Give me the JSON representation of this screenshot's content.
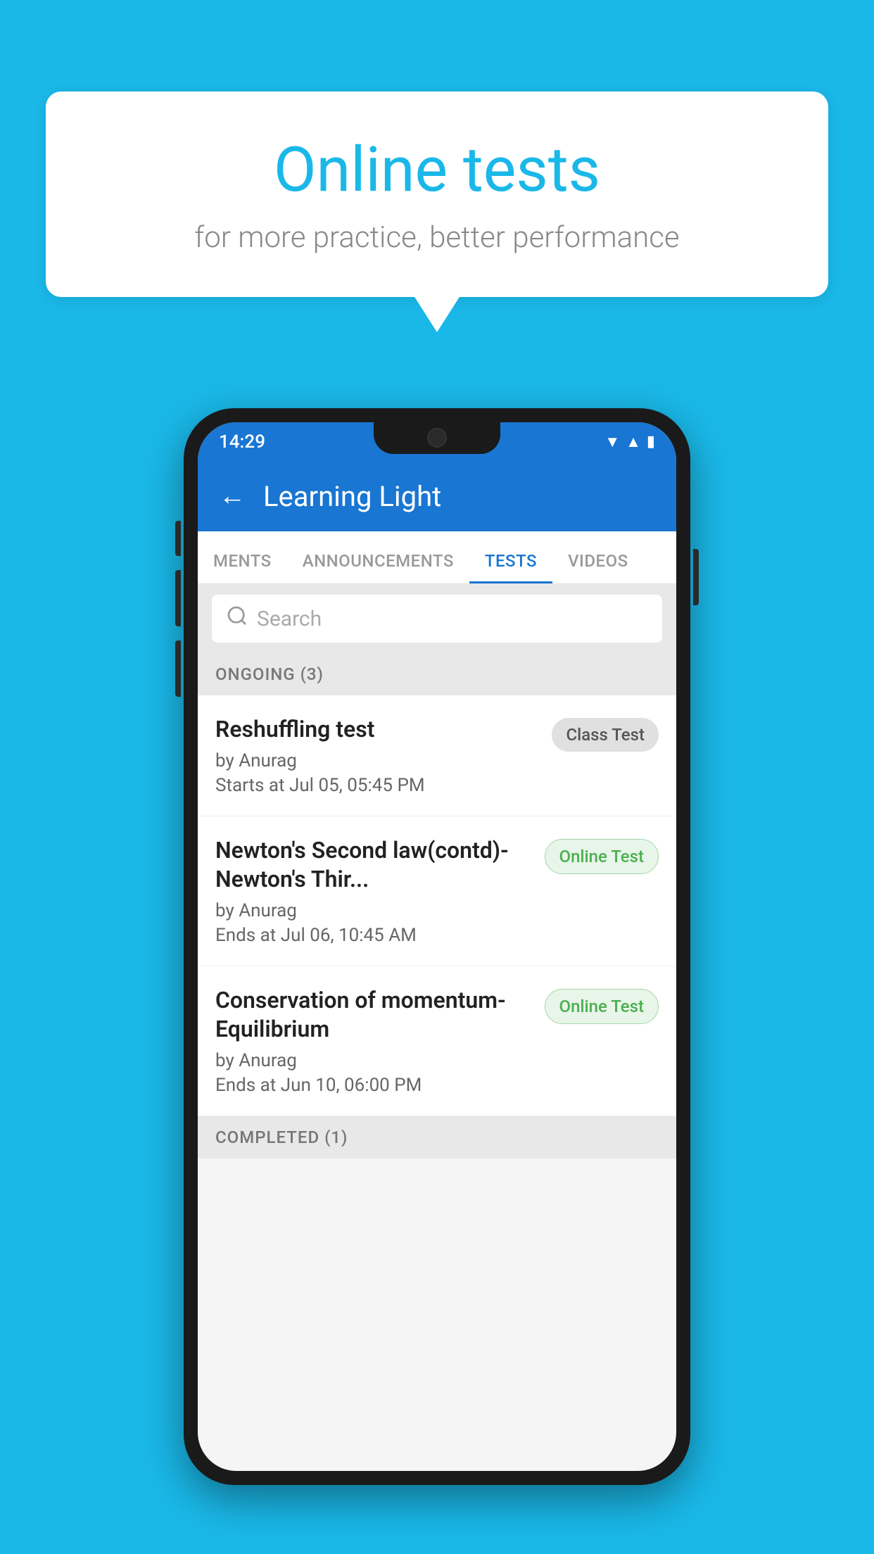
{
  "background_color": "#1ab8e8",
  "speech_bubble": {
    "title": "Online tests",
    "subtitle": "for more practice, better performance"
  },
  "phone": {
    "status_bar": {
      "time": "14:29",
      "icons": [
        "wifi",
        "signal",
        "battery"
      ]
    },
    "header": {
      "back_label": "←",
      "title": "Learning Light"
    },
    "tabs": [
      {
        "label": "MENTS",
        "active": false
      },
      {
        "label": "ANNOUNCEMENTS",
        "active": false
      },
      {
        "label": "TESTS",
        "active": true
      },
      {
        "label": "VIDEOS",
        "active": false
      }
    ],
    "search": {
      "placeholder": "Search"
    },
    "ongoing_section": {
      "label": "ONGOING (3)"
    },
    "tests": [
      {
        "title": "Reshuffling test",
        "author": "by Anurag",
        "date": "Starts at  Jul 05, 05:45 PM",
        "badge": "Class Test",
        "badge_type": "class"
      },
      {
        "title": "Newton's Second law(contd)-Newton's Thir...",
        "author": "by Anurag",
        "date": "Ends at  Jul 06, 10:45 AM",
        "badge": "Online Test",
        "badge_type": "online"
      },
      {
        "title": "Conservation of momentum-Equilibrium",
        "author": "by Anurag",
        "date": "Ends at  Jun 10, 06:00 PM",
        "badge": "Online Test",
        "badge_type": "online"
      }
    ],
    "completed_section": {
      "label": "COMPLETED (1)"
    }
  }
}
